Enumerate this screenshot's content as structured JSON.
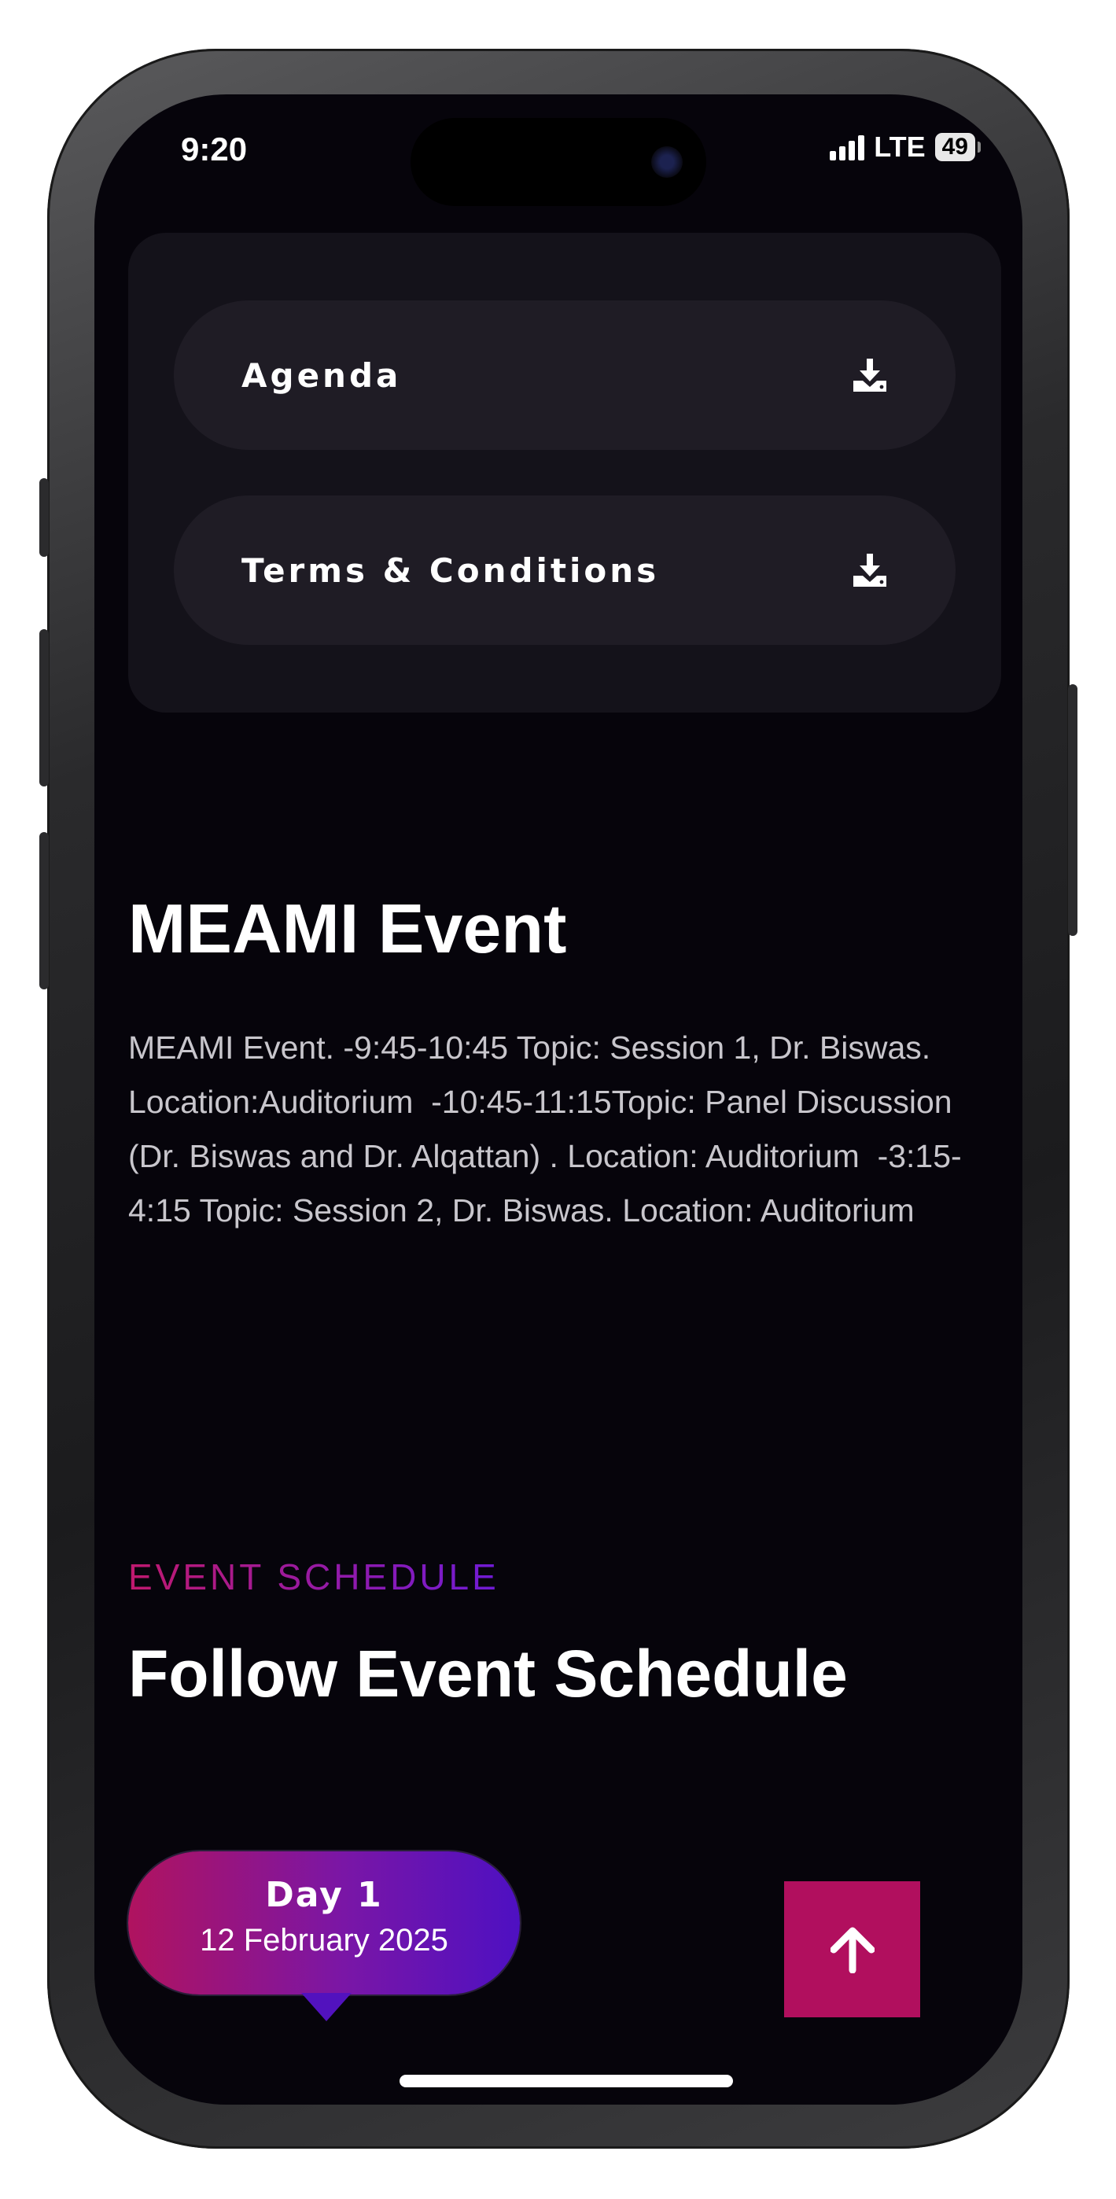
{
  "status_bar": {
    "time": "9:20",
    "network": "LTE",
    "battery": "49"
  },
  "downloads": [
    {
      "label": "Agenda",
      "icon": "download-icon"
    },
    {
      "label": "Terms & Conditions",
      "icon": "download-icon"
    }
  ],
  "event": {
    "title": "MEAMI Event",
    "description": "MEAMI Event. -9:45-10:45 Topic: Session 1, Dr. Biswas. Location:Auditorium  -10:45-11:15Topic: Panel Discussion (Dr. Biswas and Dr. Alqattan) . Location: Auditorium  -3:15-4:15 Topic: Session 2, Dr. Biswas. Location: Auditorium"
  },
  "schedule": {
    "kicker": "EVENT SCHEDULE",
    "title": "Follow Event Schedule",
    "days": [
      {
        "day": "Day 1",
        "date": "12 February 2025"
      }
    ]
  },
  "scroll_top": {
    "icon": "arrow-up-icon"
  },
  "colors": {
    "background": "#06040b",
    "card": "#14121a",
    "pill": "#1f1c25",
    "accent_pink": "#b10f5e",
    "accent_purple": "#5212be"
  }
}
